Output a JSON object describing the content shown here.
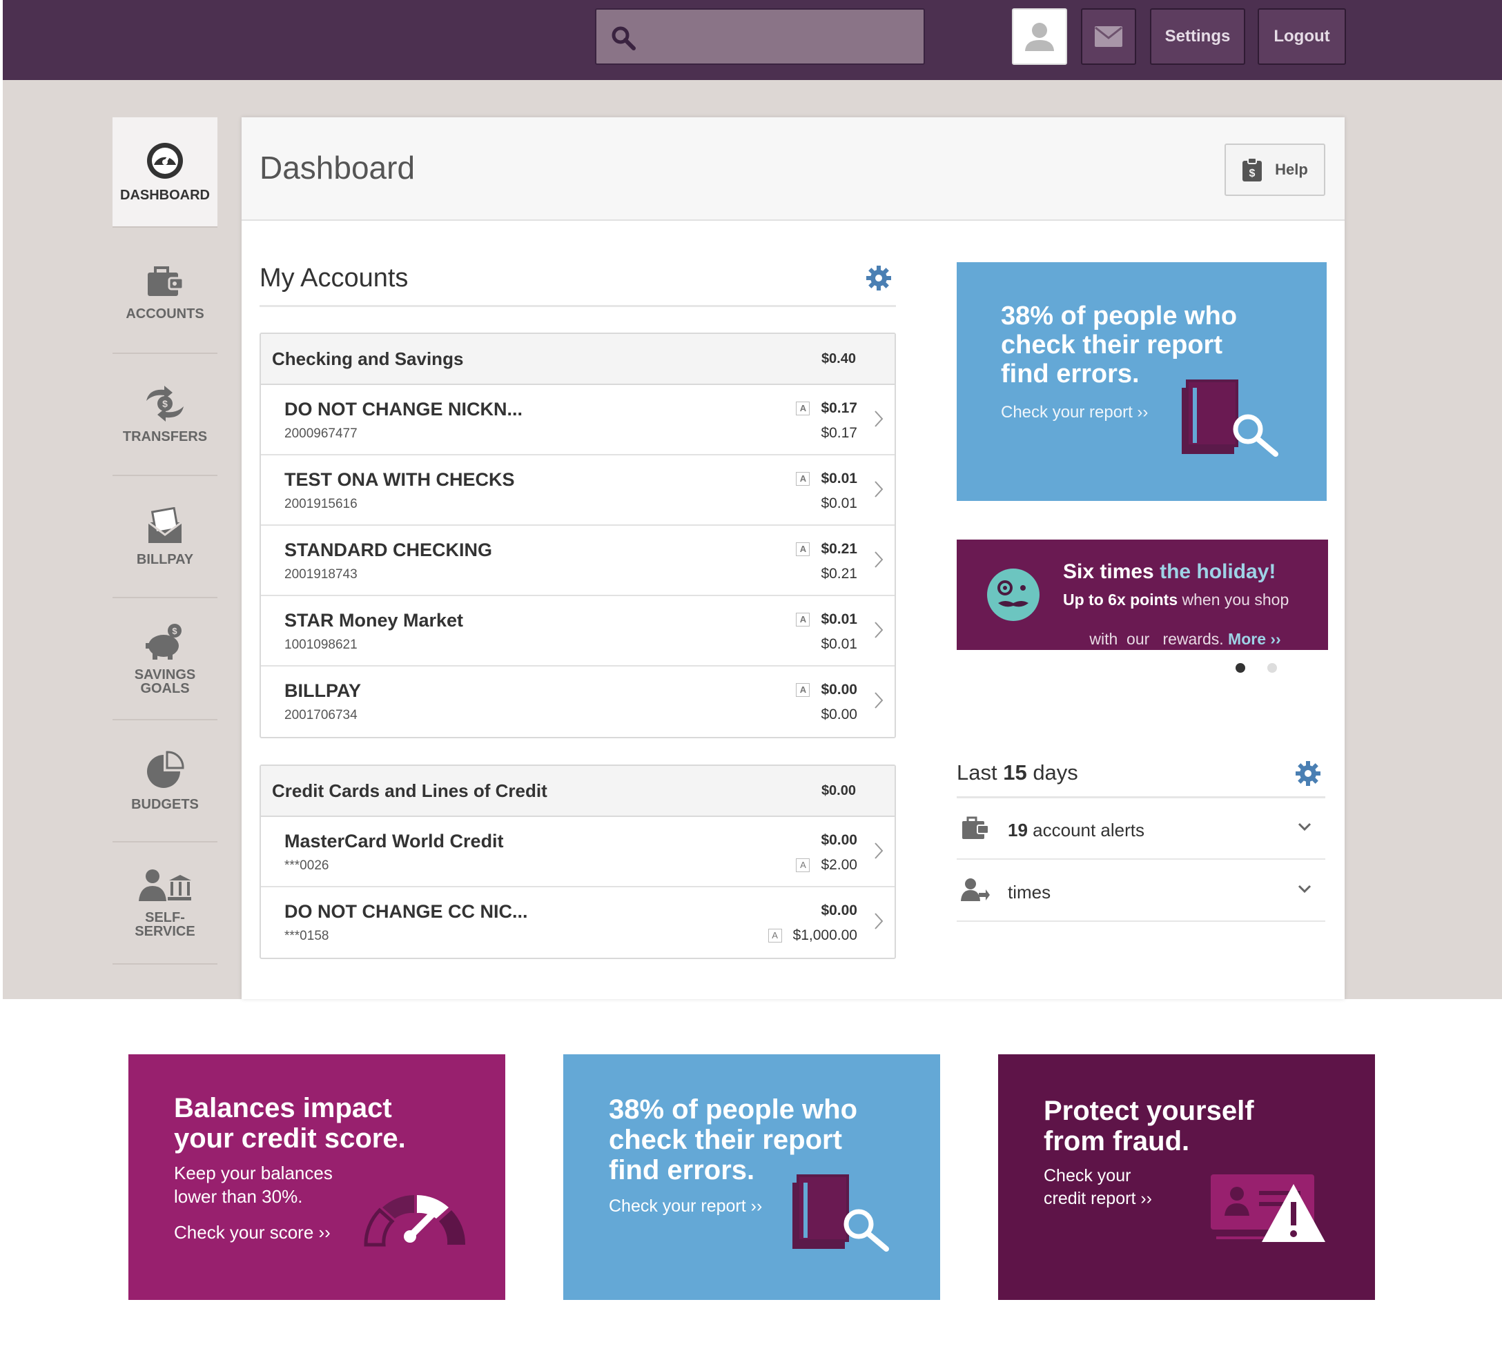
{
  "topbar": {
    "search_placeholder": "",
    "settings_label": "Settings",
    "logout_label": "Logout"
  },
  "sidebar": {
    "items": [
      {
        "label": "DASHBOARD",
        "icon": "speedometer-icon"
      },
      {
        "label": "ACCOUNTS",
        "icon": "wallet-icon"
      },
      {
        "label": "TRANSFERS",
        "icon": "transfer-icon"
      },
      {
        "label": "BILLPAY",
        "icon": "envelope-bill-icon"
      },
      {
        "label": "SAVINGS GOALS",
        "icon": "piggy-bank-icon"
      },
      {
        "label": "BUDGETS",
        "icon": "pie-chart-icon"
      },
      {
        "label": "SELF-SERVICE",
        "icon": "self-service-icon"
      }
    ]
  },
  "header": {
    "title": "Dashboard",
    "help_label": "Help"
  },
  "accounts": {
    "title": "My Accounts",
    "groups": [
      {
        "name": "Checking and Savings",
        "total": "$0.40",
        "rows": [
          {
            "name": "DO NOT CHANGE NICKN...",
            "number": "2000967477",
            "available": "$0.17",
            "current": "$0.17"
          },
          {
            "name": "TEST ONA WITH CHECKS",
            "number": "2001915616",
            "available": "$0.01",
            "current": "$0.01"
          },
          {
            "name": "STANDARD CHECKING",
            "number": "2001918743",
            "available": "$0.21",
            "current": "$0.21"
          },
          {
            "name": "STAR  Money Market",
            "number": "1001098621",
            "available": "$0.01",
            "current": "$0.01"
          },
          {
            "name": "BILLPAY",
            "number": "2001706734",
            "available": "$0.00",
            "current": "$0.00"
          }
        ]
      },
      {
        "name": "Credit Cards and Lines of Credit",
        "total": "$0.00",
        "rows": [
          {
            "name": "MasterCard World Credit",
            "number": "***0026",
            "available": "$0.00",
            "current": "$2.00"
          },
          {
            "name": "DO NOT CHANGE CC NIC...",
            "number": "***0158",
            "available": "$0.00",
            "current": "$1,000.00"
          }
        ]
      }
    ],
    "badge": "A"
  },
  "ad_report": {
    "title_lines": [
      "38% of people who",
      "check their report",
      "find errors."
    ],
    "link": "Check your report ››"
  },
  "ad_holiday": {
    "title_a": "Six times ",
    "title_b": "the holiday!",
    "line1_bold": "Up to 6x points",
    "line1_rest": " when you shop",
    "line2": "with  our   rewards. ",
    "more": "More ››"
  },
  "last_days": {
    "label_pre": "Last ",
    "days": "15",
    "label_post": " days",
    "alerts_count": "19",
    "alerts_label": " account alerts",
    "times_label": "times"
  },
  "cards": [
    {
      "title_lines": [
        "Balances impact",
        "your credit score."
      ],
      "text_lines": [
        "Keep your balances",
        "lower than 30%."
      ],
      "link": "Check your score ››",
      "color": "#98206e"
    },
    {
      "title_lines": [
        "38% of people who",
        "check their report",
        "find errors."
      ],
      "link": "Check your report ››",
      "color": "#64a8d6"
    },
    {
      "title_lines": [
        "Protect yourself",
        "from fraud."
      ],
      "text_lines": [
        "Check your",
        "credit report ››"
      ],
      "color": "#5e1448"
    }
  ],
  "colors": {
    "topbar": "#4c3050",
    "backdrop": "#ddd7d4",
    "accent_blue": "#4a7fb3",
    "ad_blue": "#64a8d6",
    "plum": "#6a1a52"
  }
}
